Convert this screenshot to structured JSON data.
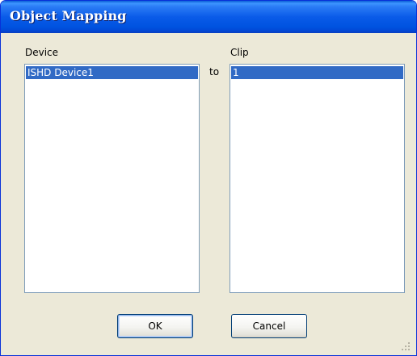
{
  "window": {
    "title": "Object Mapping"
  },
  "device": {
    "label": "Device",
    "items": [
      "ISHD Device1"
    ],
    "selected_index": 0
  },
  "connector": {
    "label": "to"
  },
  "clip": {
    "label": "Clip",
    "items": [
      "1"
    ],
    "selected_index": 0
  },
  "buttons": {
    "ok_label": "OK",
    "cancel_label": "Cancel"
  },
  "colors": {
    "title_bar": "#0a5be8",
    "dialog_bg": "#ece9d8",
    "selection": "#316ac5",
    "list_border": "#7f9db9"
  }
}
